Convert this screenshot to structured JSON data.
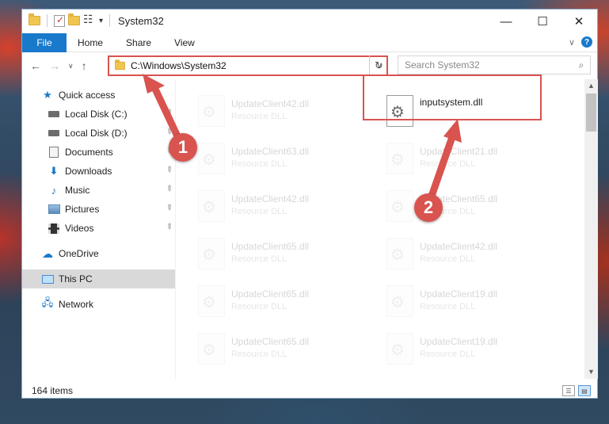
{
  "window": {
    "title": "System32",
    "controls": {
      "minimize": "—",
      "maximize": "☐",
      "close": "✕"
    }
  },
  "ribbon": {
    "file_tab": "File",
    "tabs": [
      "Home",
      "Share",
      "View"
    ],
    "help": "?",
    "expand": "∨"
  },
  "nav": {
    "back": "←",
    "forward": "→",
    "recent": "∨",
    "up": "↑",
    "address": "C:\\Windows\\System32",
    "address_dropdown": "∨",
    "refresh": "↻",
    "search_placeholder": "Search System32",
    "search_icon": "⌕"
  },
  "sidebar": {
    "items": [
      {
        "label": "Quick access",
        "icon": "star-icon",
        "pinned": false
      },
      {
        "label": "Local Disk (C:)",
        "icon": "drive-icon",
        "pinned": true
      },
      {
        "label": "Local Disk (D:)",
        "icon": "drive-icon",
        "pinned": true
      },
      {
        "label": "Documents",
        "icon": "documents-icon",
        "pinned": true
      },
      {
        "label": "Downloads",
        "icon": "downloads-icon",
        "pinned": true
      },
      {
        "label": "Music",
        "icon": "music-icon",
        "pinned": true
      },
      {
        "label": "Pictures",
        "icon": "pictures-icon",
        "pinned": true
      },
      {
        "label": "Videos",
        "icon": "videos-icon",
        "pinned": true
      },
      {
        "label": "OneDrive",
        "icon": "cloud-icon",
        "pinned": false
      },
      {
        "label": "This PC",
        "icon": "computer-icon",
        "pinned": false,
        "selected": true
      },
      {
        "label": "Network",
        "icon": "network-icon",
        "pinned": false
      }
    ],
    "pin_glyph": "📌"
  },
  "files": {
    "left_column": [
      {
        "name": "UpdateClient42.dll",
        "type": "Resource DLL"
      },
      {
        "name": "UpdateClient63.dll",
        "type": "Resource DLL"
      },
      {
        "name": "UpdateClient42.dll",
        "type": "Resource DLL"
      },
      {
        "name": "UpdateClient65.dll",
        "type": "Resource DLL"
      },
      {
        "name": "UpdateClient65.dll",
        "type": "Resource DLL"
      },
      {
        "name": "UpdateClient65.dll",
        "type": "Resource DLL"
      }
    ],
    "right_column": [
      {
        "name": "inputsystem.dll",
        "type": "",
        "highlighted": true
      },
      {
        "name": "UpdateClient21.dll",
        "type": "Resource DLL"
      },
      {
        "name": "UpdateClient65.dll",
        "type": "Resource DLL"
      },
      {
        "name": "UpdateClient42.dll",
        "type": "Resource DLL"
      },
      {
        "name": "UpdateClient19.dll",
        "type": "Resource DLL"
      },
      {
        "name": "UpdateClient19.dll",
        "type": "Resource DLL"
      }
    ]
  },
  "status": {
    "item_count": "164 items"
  },
  "annotations": {
    "step1": "1",
    "step2": "2",
    "color": "#d9534f"
  },
  "colors": {
    "accent": "#1979ca",
    "highlight_red": "#d9534f",
    "selected_bg": "#d9d9d9"
  }
}
